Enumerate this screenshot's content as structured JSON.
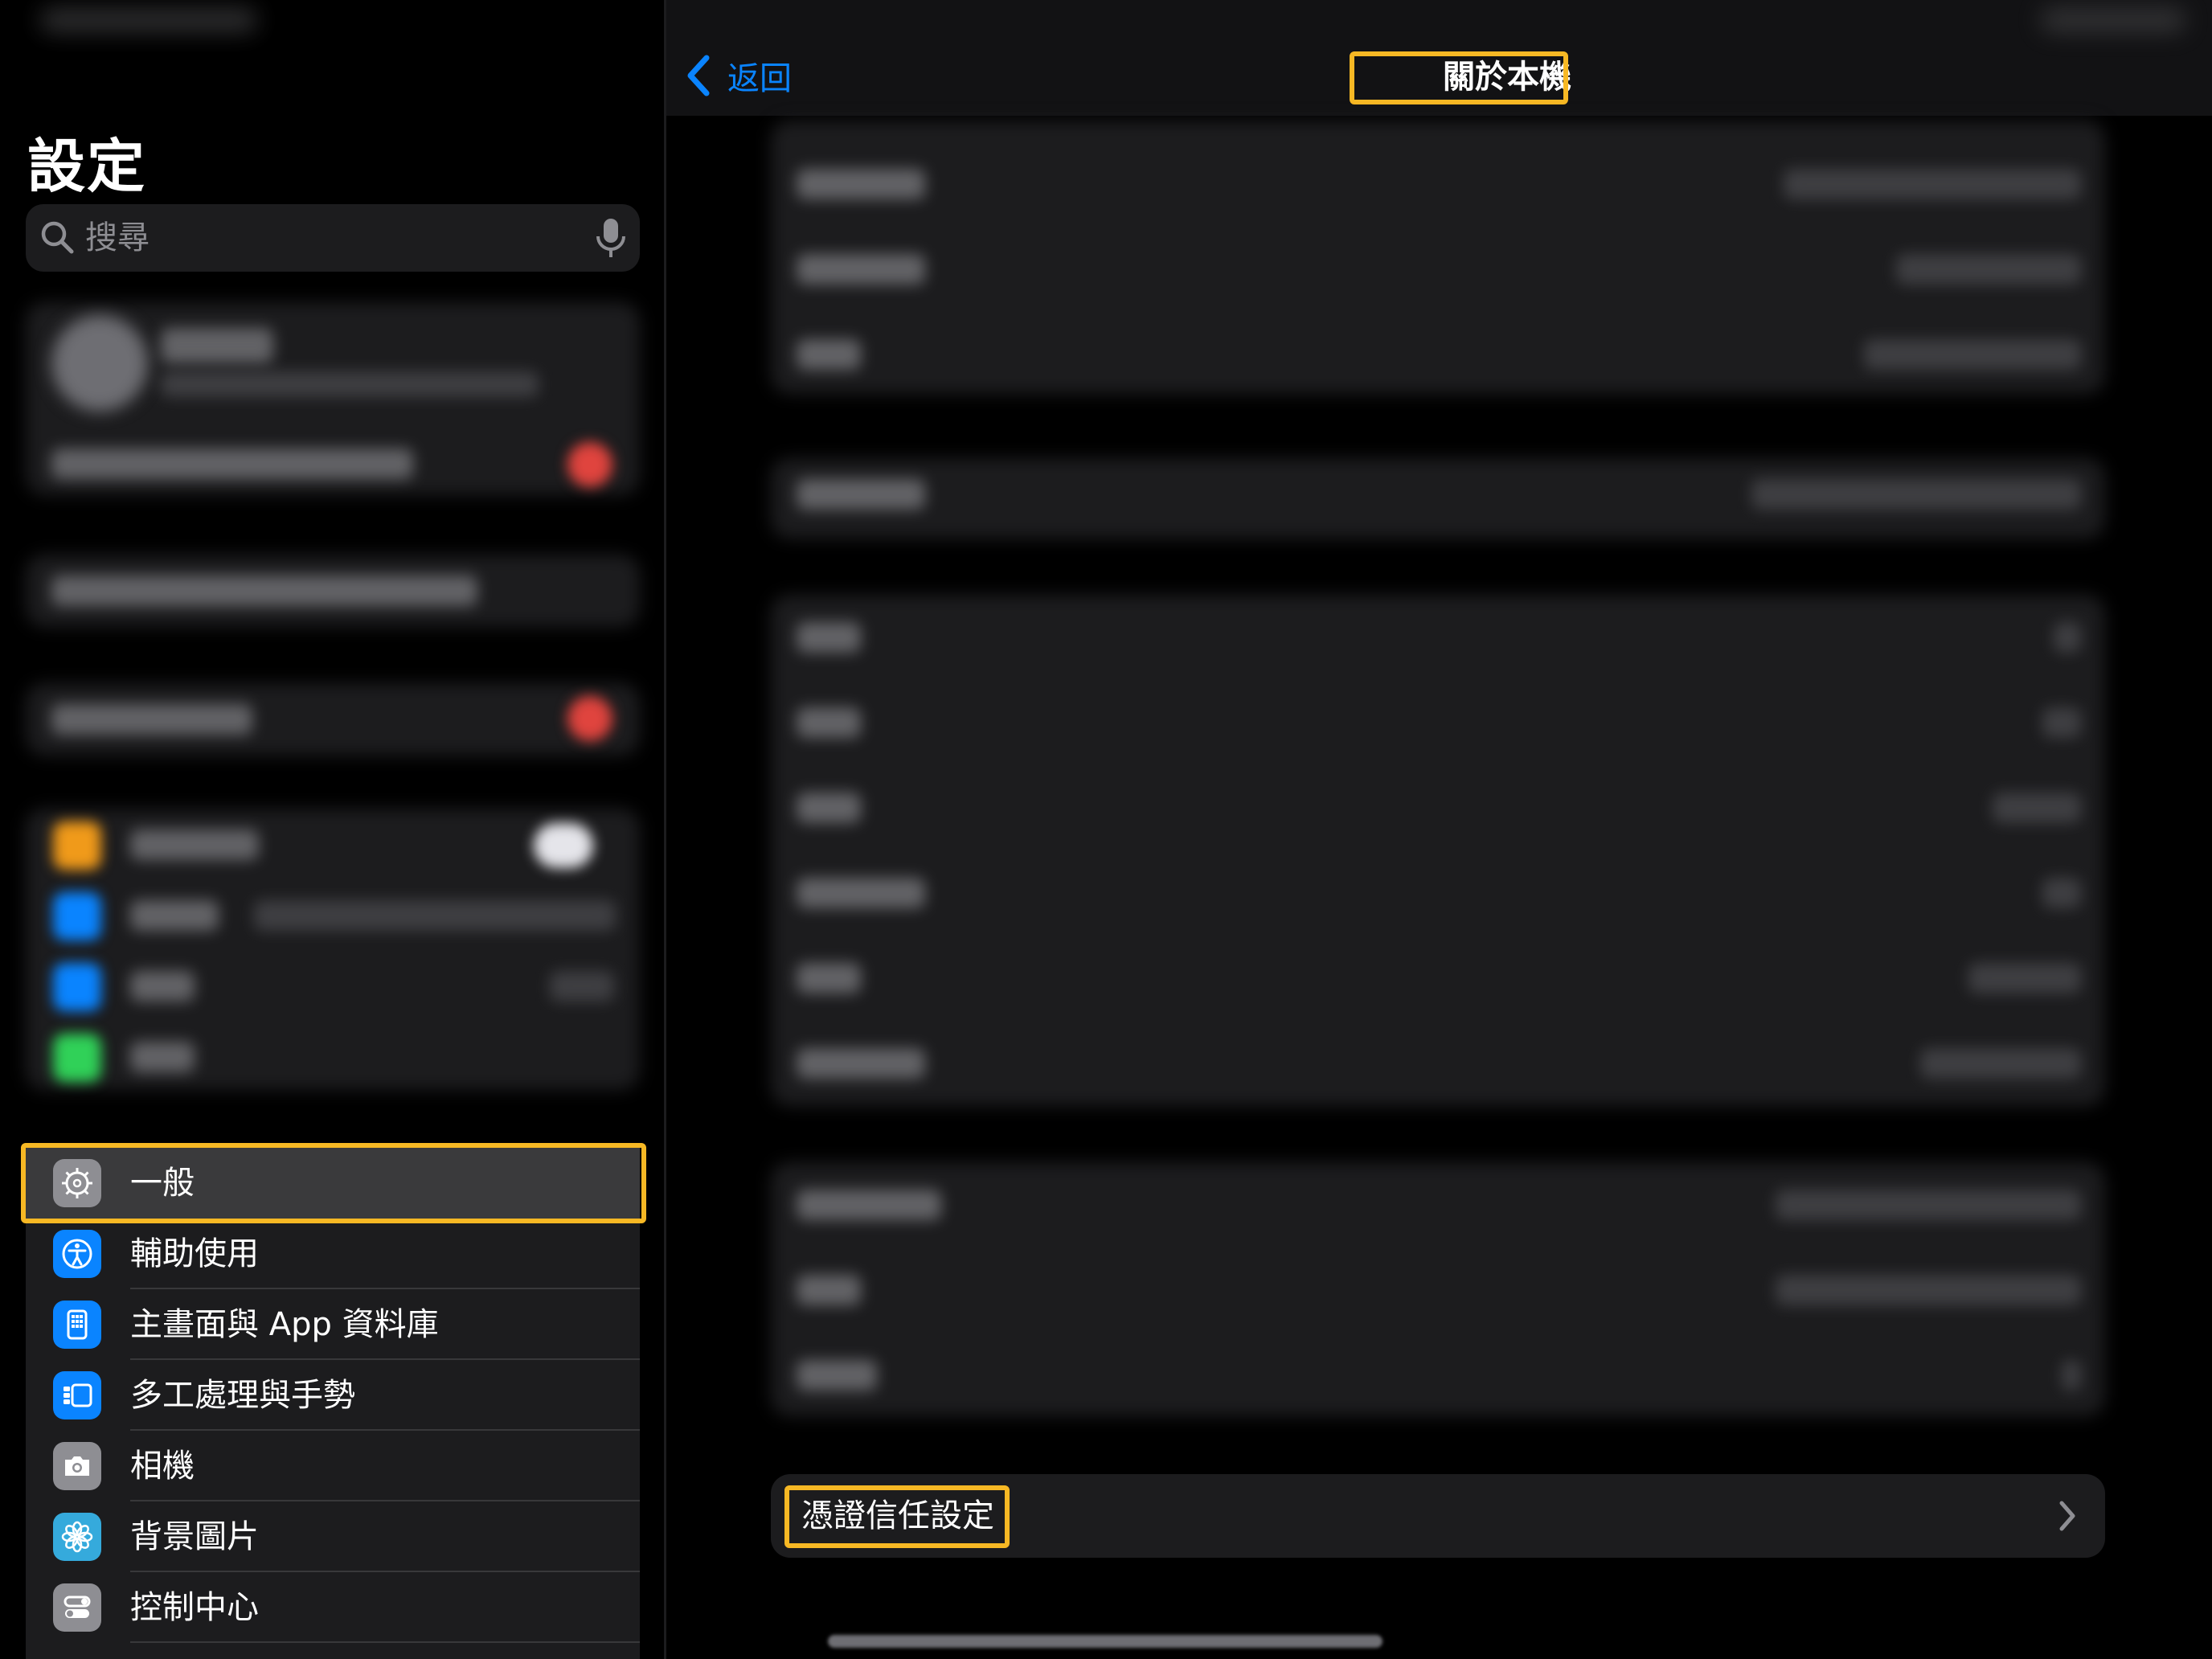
{
  "sidebar": {
    "title": "設定",
    "search": {
      "placeholder": "搜尋"
    },
    "menu": [
      {
        "label": "一般",
        "icon": "gear-icon",
        "color": "#8e8e93",
        "selected": true
      },
      {
        "label": "輔助使用",
        "icon": "accessibility-icon",
        "color": "#0a84ff",
        "selected": false
      },
      {
        "label": "主畫面與 App 資料庫",
        "icon": "home-screen-icon",
        "color": "#0a84ff",
        "selected": false
      },
      {
        "label": "多工處理與手勢",
        "icon": "multitasking-icon",
        "color": "#0a84ff",
        "selected": false
      },
      {
        "label": "相機",
        "icon": "camera-icon",
        "color": "#8e8e93",
        "selected": false
      },
      {
        "label": "背景圖片",
        "icon": "wallpaper-icon",
        "color": "#35aadc",
        "selected": false
      },
      {
        "label": "控制中心",
        "icon": "control-center-icon",
        "color": "#8e8e93",
        "selected": false
      }
    ]
  },
  "detail": {
    "back_label": "返回",
    "title": "關於本機",
    "certificate_trust_label": "憑證信任設定"
  },
  "colors": {
    "accent": "#0a84ff",
    "highlight": "#f7b824",
    "group_background": "#1c1c1e"
  }
}
